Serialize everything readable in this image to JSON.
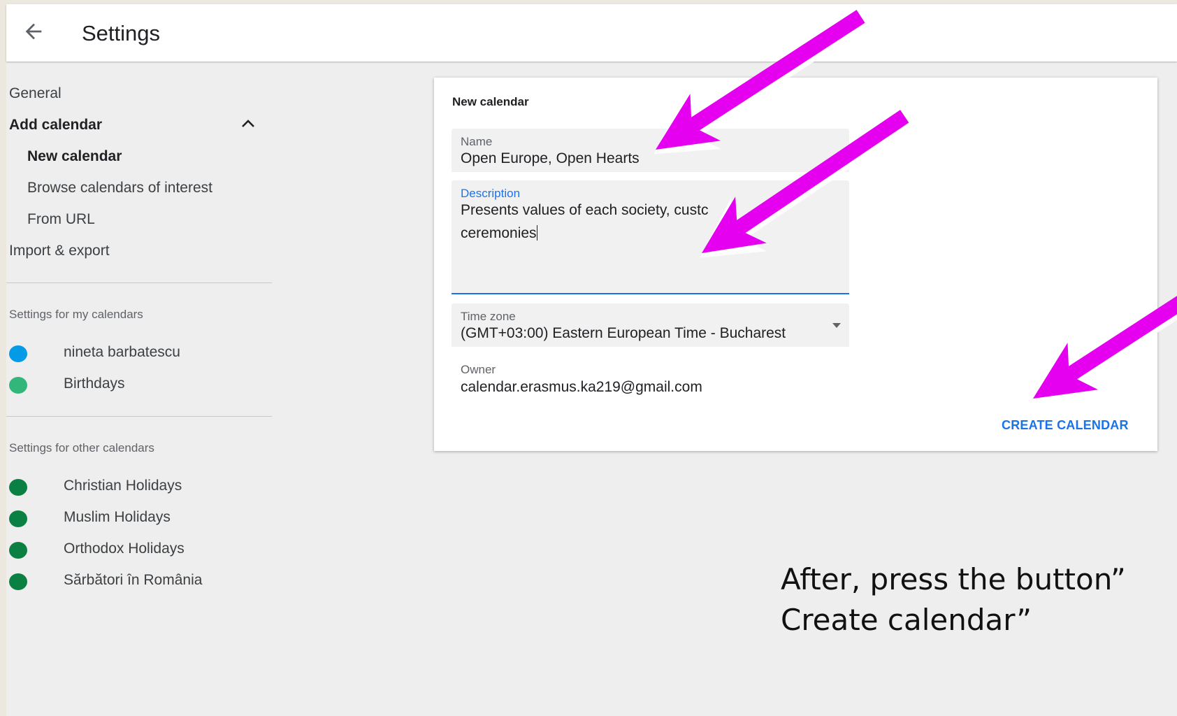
{
  "header": {
    "back_icon": "arrow-left-icon",
    "title": "Settings"
  },
  "sidebar": {
    "general": "General",
    "add_calendar": "Add calendar",
    "add_calendar_toggle_icon": "chevron-up-icon",
    "new_calendar": "New calendar",
    "browse_calendars": "Browse calendars of interest",
    "from_url": "From URL",
    "import_export": "Import & export",
    "my_calendars_title": "Settings for my calendars",
    "my_calendars": [
      {
        "name": "nineta barbatescu",
        "color": "#039be5"
      },
      {
        "name": "Birthdays",
        "color": "#33b679"
      }
    ],
    "other_calendars_title": "Settings for other calendars",
    "other_calendars": [
      {
        "name": "Christian Holidays",
        "color": "#0b8043"
      },
      {
        "name": "Muslim Holidays",
        "color": "#0b8043"
      },
      {
        "name": "Orthodox Holidays",
        "color": "#0b8043"
      },
      {
        "name": "Sărbători în România",
        "color": "#0b8043"
      }
    ]
  },
  "card": {
    "title": "New calendar",
    "name_label": "Name",
    "name_value": "Open Europe, Open Hearts",
    "description_label": "Description",
    "description_line1": "Presents values of each  society, custc",
    "description_line2": "ceremonies",
    "timezone_label": "Time zone",
    "timezone_value": "(GMT+03:00) Eastern European Time - Bucharest",
    "timezone_dropdown_icon": "caret-down-icon",
    "owner_label": "Owner",
    "owner_value": "calendar.erasmus.ka219@gmail.com",
    "create_button": "CREATE CALENDAR"
  },
  "instruction": {
    "line1": "After, press the button”",
    "line2": "Create calendar”"
  },
  "annotations": {
    "arrow_color": "#e600f0",
    "arrow_icon": "pointer-arrow-icon"
  }
}
